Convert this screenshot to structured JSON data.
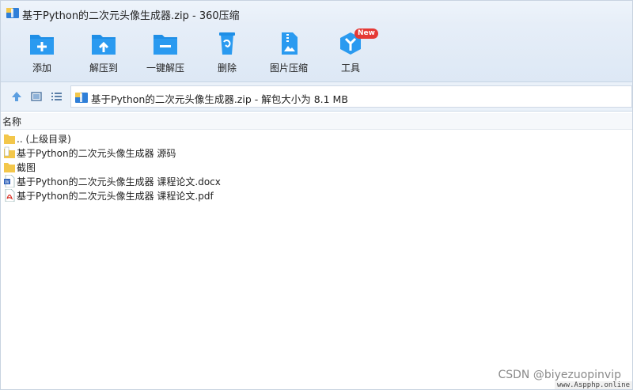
{
  "window": {
    "title": "基于Python的二次元头像生成器.zip - 360压缩"
  },
  "toolbar": {
    "items": [
      {
        "label": "添加",
        "icon": "add-folder-icon"
      },
      {
        "label": "解压到",
        "icon": "extract-to-icon"
      },
      {
        "label": "一键解压",
        "icon": "one-click-extract-icon"
      },
      {
        "label": "删除",
        "icon": "delete-icon"
      },
      {
        "label": "图片压缩",
        "icon": "image-compress-icon"
      },
      {
        "label": "工具",
        "icon": "tools-icon",
        "badge": "New"
      }
    ]
  },
  "address": {
    "path": "基于Python的二次元头像生成器.zip - 解包大小为 8.1 MB"
  },
  "list": {
    "column_name": "名称",
    "rows": [
      {
        "name": ".. (上级目录)",
        "type": "folder"
      },
      {
        "name": "基于Python的二次元头像生成器 源码",
        "type": "folder-doc"
      },
      {
        "name": "截图",
        "type": "folder"
      },
      {
        "name": "基于Python的二次元头像生成器 课程论文.docx",
        "type": "docx"
      },
      {
        "name": "基于Python的二次元头像生成器 课程论文.pdf",
        "type": "pdf"
      }
    ]
  },
  "watermark": {
    "csdn": "CSDN @biyezuopinvip",
    "site": "www.Aspphp.online"
  },
  "colors": {
    "accent": "#1e8ee6",
    "folder": "#f3c74b",
    "badge": "#e53935"
  }
}
